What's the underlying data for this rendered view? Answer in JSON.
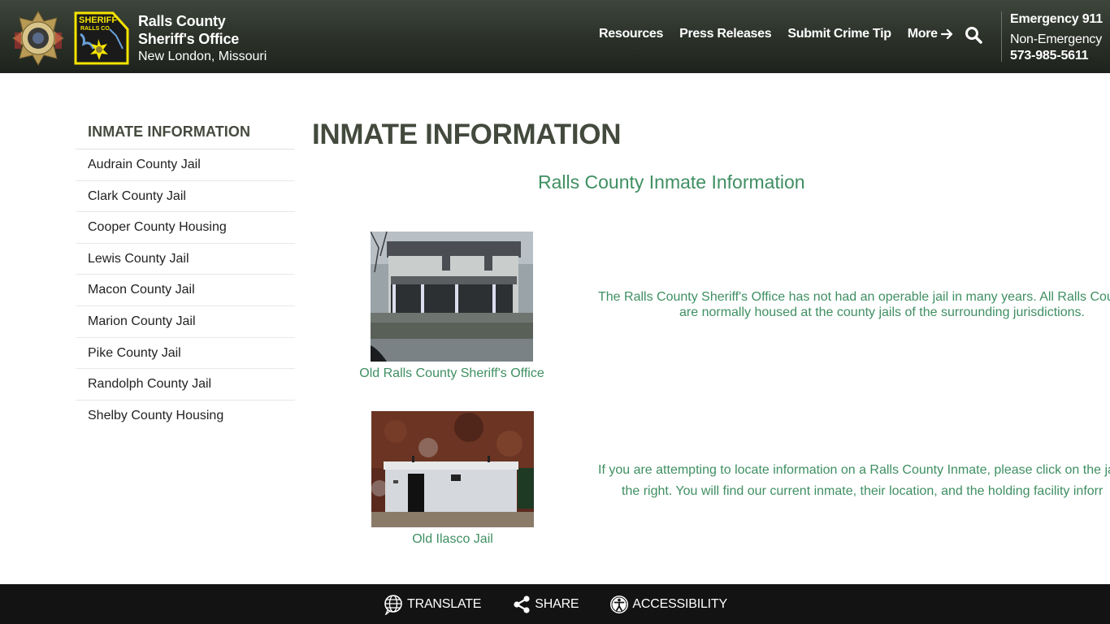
{
  "header": {
    "brand_line1": "Ralls County",
    "brand_line2": "Sheriff's Office",
    "brand_line3": "New London, Missouri",
    "nav": [
      {
        "label": "Resources"
      },
      {
        "label": "Press Releases"
      },
      {
        "label": "Submit Crime Tip"
      },
      {
        "label": "More"
      }
    ],
    "search_icon": "search-icon",
    "emergency_label": "Emergency 911",
    "non_emergency_label": "Non-Emergency",
    "non_emergency_phone": "573-985-5611"
  },
  "sidebar": {
    "title": "INMATE INFORMATION",
    "items": [
      {
        "label": "Audrain County Jail"
      },
      {
        "label": "Clark County Jail"
      },
      {
        "label": "Cooper County Housing"
      },
      {
        "label": "Lewis County Jail"
      },
      {
        "label": "Macon County Jail"
      },
      {
        "label": "Marion County Jail"
      },
      {
        "label": "Pike County Jail"
      },
      {
        "label": "Randolph County Jail"
      },
      {
        "label": "Shelby County Housing"
      }
    ]
  },
  "main": {
    "title": "INMATE INFORMATION",
    "subtitle": "Ralls County Inmate Information",
    "figures": [
      {
        "caption": "Old Ralls County Sheriff's Office"
      },
      {
        "caption": "Old Ilasco Jail"
      }
    ],
    "paragraph1": {
      "line1": "The Ralls County Sheriff's Office has not had an operable jail in many years.  All Ralls Cour",
      "line2": "are normally housed at the county jails of the surrounding jurisdictions."
    },
    "paragraph2": {
      "line1": "If you are attempting to locate information on a Ralls County Inmate, please click on the ja",
      "line2": "the right.  You will find our current inmate, their location, and the holding facility inforr"
    }
  },
  "footer": {
    "translate": "TRANSLATE",
    "share": "SHARE",
    "accessibility": "ACCESSIBILITY"
  },
  "colors": {
    "header_bg": "#2c3229",
    "accent_green": "#3f8f62",
    "title_dark": "#434a3d",
    "footer_bg": "#131313"
  }
}
